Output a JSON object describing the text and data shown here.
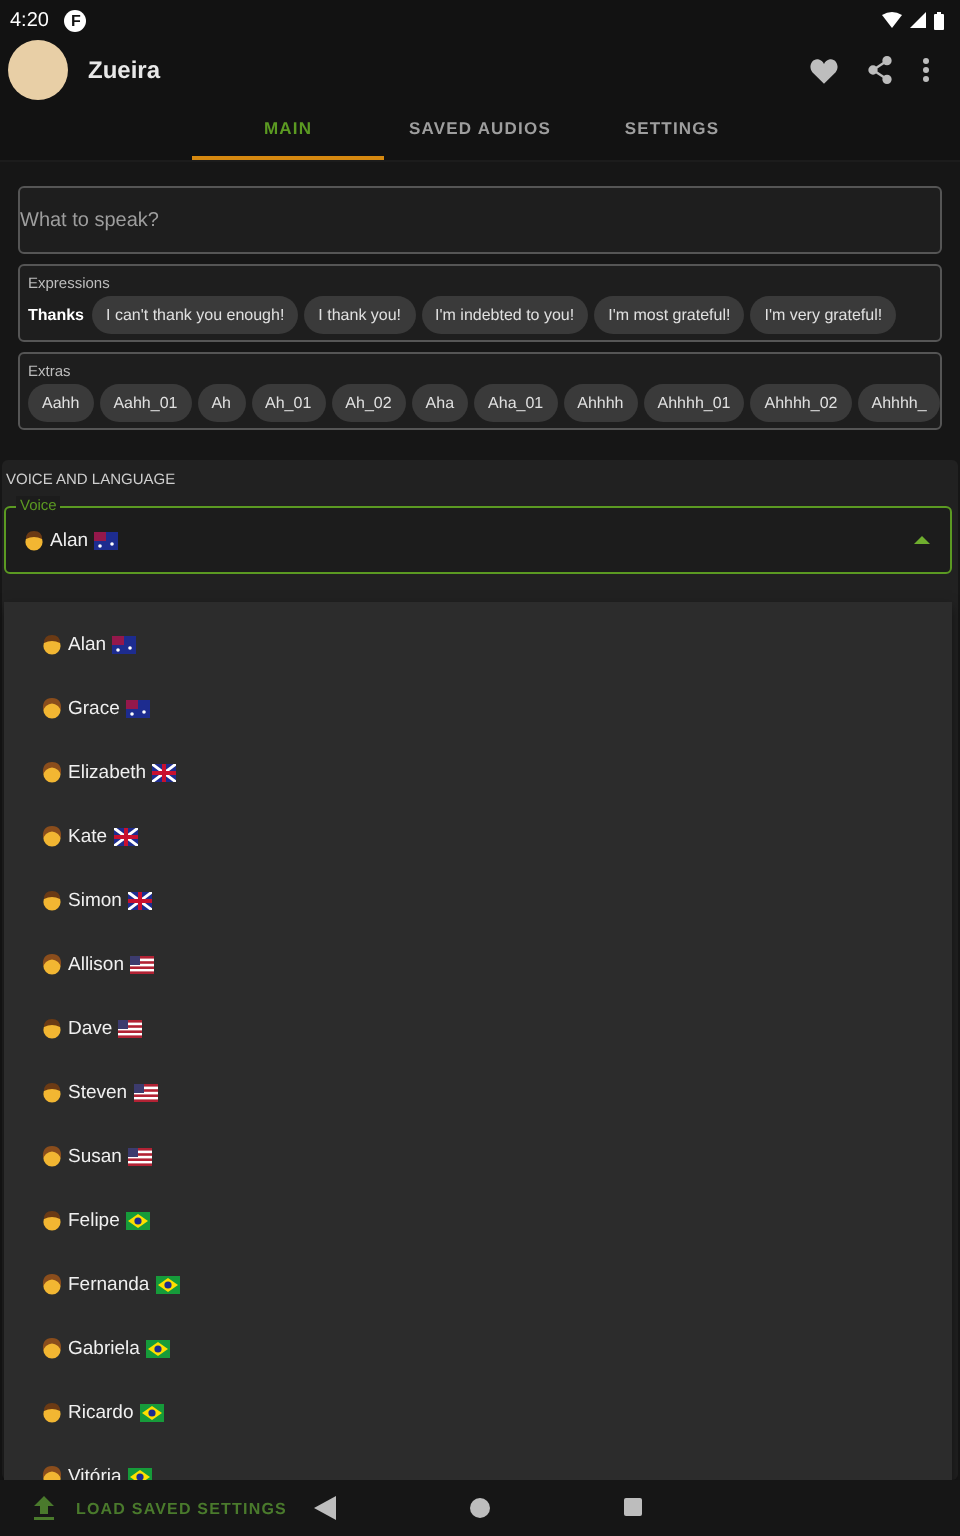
{
  "status_bar": {
    "time": "4:20",
    "notification": "F"
  },
  "app_bar": {
    "title": "Zueira"
  },
  "tabs": [
    {
      "label": "MAIN",
      "selected": true
    },
    {
      "label": "SAVED AUDIOS",
      "selected": false
    },
    {
      "label": "SETTINGS",
      "selected": false
    }
  ],
  "speak_field": {
    "placeholder": "What to speak?"
  },
  "expressions": {
    "title": "Expressions",
    "group": "Thanks",
    "chips": [
      "I can't thank you enough!",
      "I thank you!",
      "I'm indebted to you!",
      "I'm most grateful!",
      "I'm very grateful!"
    ]
  },
  "extras": {
    "title": "Extras",
    "chips": [
      "Aahh",
      "Aahh_01",
      "Ah",
      "Ah_01",
      "Ah_02",
      "Aha",
      "Aha_01",
      "Ahhhh",
      "Ahhhh_01",
      "Ahhhh_02",
      "Ahhhh_"
    ]
  },
  "voice_section": {
    "title": "VOICE AND LANGUAGE",
    "field_label": "Voice",
    "value": {
      "name": "Alan",
      "kind": "man_au"
    },
    "expanded": true
  },
  "voice_options": [
    {
      "name": "Alan",
      "kind": "man_au"
    },
    {
      "name": "Grace",
      "kind": "woman_au"
    },
    {
      "name": "Elizabeth",
      "kind": "woman_gb"
    },
    {
      "name": "Kate",
      "kind": "woman_gb"
    },
    {
      "name": "Simon",
      "kind": "man_gb"
    },
    {
      "name": "Allison",
      "kind": "woman_us"
    },
    {
      "name": "Dave",
      "kind": "man_us"
    },
    {
      "name": "Steven",
      "kind": "man_us"
    },
    {
      "name": "Susan",
      "kind": "woman_us"
    },
    {
      "name": "Felipe",
      "kind": "man_br"
    },
    {
      "name": "Fernanda",
      "kind": "woman_br"
    },
    {
      "name": "Gabriela",
      "kind": "woman_br"
    },
    {
      "name": "Ricardo",
      "kind": "man_br"
    },
    {
      "name": "Vitória",
      "kind": "woman_br"
    }
  ],
  "bottom_button": {
    "label": "LOAD SAVED SETTINGS",
    "disabled": true
  }
}
